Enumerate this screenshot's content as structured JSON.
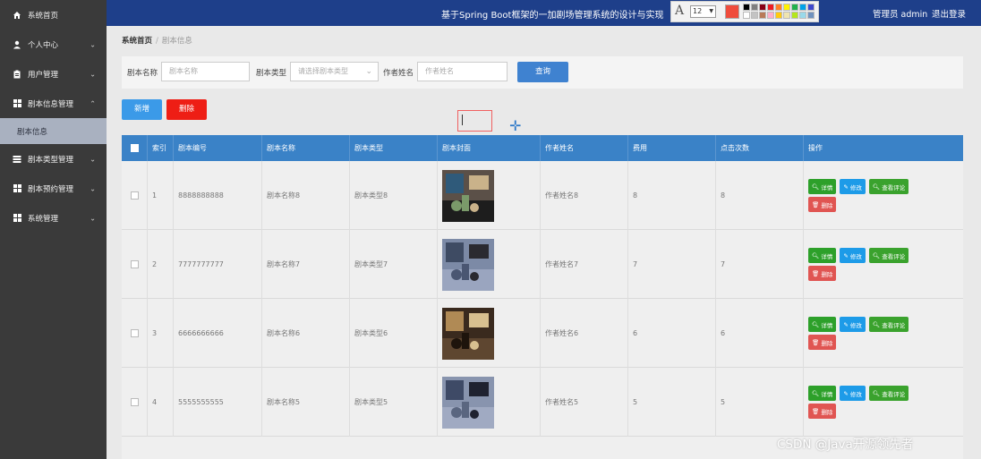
{
  "app_title": "基于Spring Boot框架的一加剧场管理系统的设计与实现",
  "user": {
    "label": "管理员 admin",
    "logout": "退出登录"
  },
  "sidebar": {
    "items": [
      {
        "label": "系统首页",
        "icon": "home-icon"
      },
      {
        "label": "个人中心",
        "icon": "user-icon"
      },
      {
        "label": "用户管理",
        "icon": "clipboard-icon"
      },
      {
        "label": "剧本信息管理",
        "icon": "grid-icon"
      },
      {
        "label": "剧本类型管理",
        "icon": "list-icon"
      },
      {
        "label": "剧本预约管理",
        "icon": "grid-icon"
      },
      {
        "label": "系统管理",
        "icon": "grid-icon"
      }
    ],
    "active_sub": "剧本信息"
  },
  "annotation_toolbar": {
    "font_size": "12",
    "current_color": "#ef4c3c",
    "swatches": [
      "#000000",
      "#7f7f7f",
      "#880015",
      "#ed1c24",
      "#ff7f27",
      "#fff200",
      "#22b14c",
      "#00a2e8",
      "#3f48cc",
      "#ffffff",
      "#c3c3c3",
      "#b97a57",
      "#ffaec9",
      "#ffc90e",
      "#efe4b0",
      "#b5e61d",
      "#99d9ea",
      "#7092be"
    ]
  },
  "breadcrumb": {
    "home": "系统首页",
    "current": "剧本信息"
  },
  "search": {
    "name_label": "剧本名称",
    "name_placeholder": "剧本名称",
    "type_label": "剧本类型",
    "type_placeholder": "请选择剧本类型",
    "author_label": "作者姓名",
    "author_placeholder": "作者姓名",
    "query_button": "查询"
  },
  "actions": {
    "add": "新增",
    "delete": "删除"
  },
  "table": {
    "columns": [
      "索引",
      "剧本编号",
      "剧本名称",
      "剧本类型",
      "剧本封面",
      "作者姓名",
      "费用",
      "点击次数",
      "操作"
    ],
    "op_labels": {
      "detail": "详情",
      "edit": "修改",
      "review": "查看评论",
      "remove": "删除"
    },
    "rows": [
      {
        "index": "1",
        "code": "8888888888",
        "name": "剧本名称8",
        "type": "剧本类型8",
        "author": "作者姓名8",
        "fee": "8",
        "clicks": "8"
      },
      {
        "index": "2",
        "code": "7777777777",
        "name": "剧本名称7",
        "type": "剧本类型7",
        "author": "作者姓名7",
        "fee": "7",
        "clicks": "7"
      },
      {
        "index": "3",
        "code": "6666666666",
        "name": "剧本名称6",
        "type": "剧本类型6",
        "author": "作者姓名6",
        "fee": "6",
        "clicks": "6"
      },
      {
        "index": "4",
        "code": "5555555555",
        "name": "剧本名称5",
        "type": "剧本类型5",
        "author": "作者姓名5",
        "fee": "5",
        "clicks": "5"
      }
    ]
  },
  "watermark": "CSDN @Java开源领先者"
}
